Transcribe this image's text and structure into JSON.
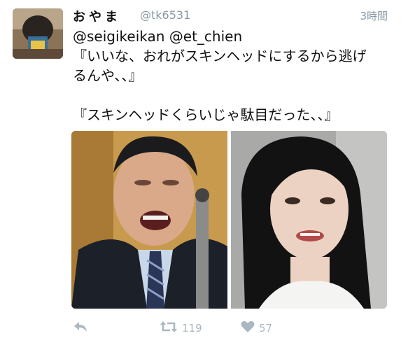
{
  "tweet": {
    "display_name": "おやま",
    "handle": "@tk6531",
    "timestamp": "3時間",
    "text_lines": [
      "@seigikeikan @et_chien",
      "『いいな、おれがスキンヘッドにするから逃げ",
      "るんや、、』",
      "",
      "『スキンヘッドくらいじゃ駄目だった、、』"
    ]
  },
  "actions": {
    "reply_icon": "reply-arrow-icon",
    "retweet_icon": "retweet-icon",
    "retweet_count": "119",
    "like_icon": "heart-icon",
    "like_count": "57"
  },
  "colors": {
    "muted_text": "#8899a6",
    "action_gray": "#aab8c2"
  }
}
